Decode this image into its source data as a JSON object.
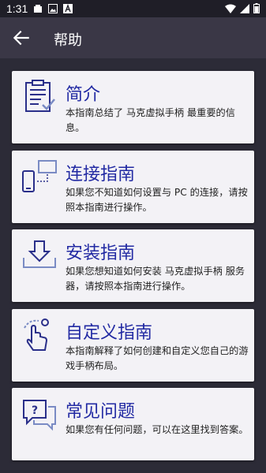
{
  "status_bar": {
    "time": "1:31"
  },
  "app_bar": {
    "title": "帮助"
  },
  "cards": [
    {
      "title": "简介",
      "description": "本指南总结了 马克虚拟手柄 最重要的信息。",
      "icon": "document-check-icon"
    },
    {
      "title": "连接指南",
      "description": "如果您不知道如何设置与 PC 的连接，请按照本指南进行操作。",
      "icon": "phone-monitor-connection-icon"
    },
    {
      "title": "安装指南",
      "description": "如果您想知道如何安装 马克虚拟手柄 服务器，请按照本指南进行操作。",
      "icon": "download-tray-icon"
    },
    {
      "title": "自定义指南",
      "description": "本指南解释了如何创建和自定义您自己的游戏手柄布局。",
      "icon": "hand-tap-icon"
    },
    {
      "title": "常见问题",
      "description": "如果您有任何问题，可以在这里找到答案。",
      "icon": "question-chat-icon"
    }
  ],
  "colors": {
    "accent": "#222aa3",
    "background": "#2c2b37",
    "card": "#f3f2f6",
    "app_bar": "#3a3746"
  }
}
